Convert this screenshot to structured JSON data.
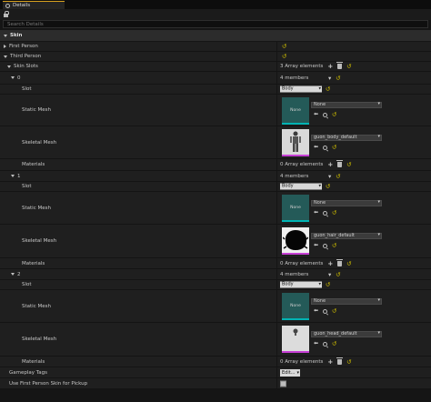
{
  "tab": {
    "title": "Details"
  },
  "search": {
    "placeholder": "Search Details"
  },
  "category": {
    "label": "Skin"
  },
  "first_person": {
    "label": "First Person"
  },
  "third_person": {
    "label": "Third Person"
  },
  "skin_slots": {
    "label": "Skin Slots",
    "count": "3 Array elements"
  },
  "elements": [
    {
      "index": "0",
      "members": "4 members",
      "slot_label": "Slot",
      "slot_value": "Body",
      "static_label": "Static Mesh",
      "static_thumb": "None",
      "static_value": "None",
      "skeletal_label": "Skeletal Mesh",
      "skeletal_value": "guon_body_default",
      "materials_label": "Materials",
      "materials_count": "0 Array elements"
    },
    {
      "index": "1",
      "members": "4 members",
      "slot_label": "Slot",
      "slot_value": "Body",
      "static_label": "Static Mesh",
      "static_thumb": "None",
      "static_value": "None",
      "skeletal_label": "Skeletal Mesh",
      "skeletal_value": "guon_hair_default",
      "materials_label": "Materials",
      "materials_count": "0 Array elements"
    },
    {
      "index": "2",
      "members": "4 members",
      "slot_label": "Slot",
      "slot_value": "Body",
      "static_label": "Static Mesh",
      "static_thumb": "None",
      "static_value": "None",
      "skeletal_label": "Skeletal Mesh",
      "skeletal_value": "guon_head_default",
      "materials_label": "Materials",
      "materials_count": "0 Array elements"
    }
  ],
  "gameplay_tags": {
    "label": "Gameplay Tags",
    "button": "Edit..."
  },
  "use_first_person": {
    "label": "Use First Person Skin for Pickup"
  },
  "colors": {
    "accent": "#d6a01f",
    "reset": "#c9b800",
    "thumb_none": "#245a58",
    "teal": "#00b3b3",
    "magenta": "#c63fd5"
  }
}
